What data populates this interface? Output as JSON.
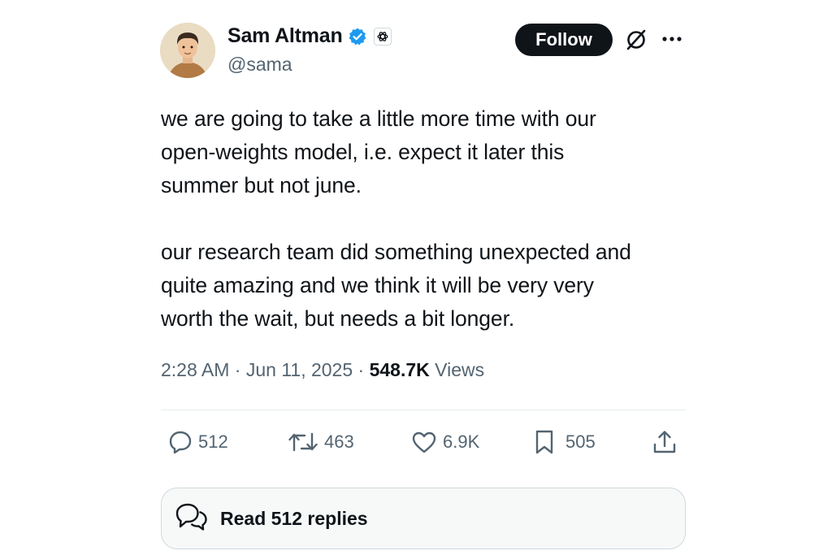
{
  "author": {
    "display_name": "Sam Altman",
    "handle": "@sama",
    "verified_icon": "verified-badge-icon",
    "affiliation_icon": "openai-logo-icon",
    "avatar": "avatar-illustration"
  },
  "header": {
    "follow_label": "Follow",
    "grok_icon": "grok-icon",
    "more_icon": "more-icon"
  },
  "tweet": {
    "text": "we are going to take a little more time with our\nopen-weights model, i.e. expect it later this\nsummer but not june.\n\nour research team did something unexpected and\nquite amazing and we think it will be very very\nworth the wait, but needs a bit longer.",
    "time": "2:28 AM",
    "date": "Jun 11, 2025",
    "views_count": "548.7K",
    "views_label": "Views",
    "separator": "·"
  },
  "actions": {
    "replies": "512",
    "reposts": "463",
    "likes": "6.9K",
    "bookmarks": "505"
  },
  "footer": {
    "read_replies_label": "Read 512 replies"
  },
  "colors": {
    "text_primary": "#0f1419",
    "text_secondary": "#536471",
    "verified_blue": "#1d9bf0",
    "border": "#cfd9de"
  }
}
